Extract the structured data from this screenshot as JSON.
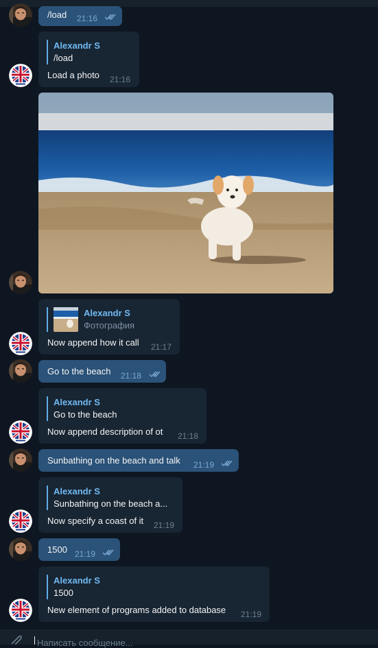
{
  "messages": [
    {
      "text": "/load",
      "time": "21:16"
    },
    {
      "reply_name": "Alexandr S",
      "reply_text": "/load",
      "text": "Load a photo",
      "time": "21:16"
    },
    {
      "reply_name": "Alexandr S",
      "reply_text": "Фотография",
      "text": "Now append how it call",
      "time": "21:17"
    },
    {
      "text": "Go to the beach",
      "time": "21:18"
    },
    {
      "reply_name": "Alexandr S",
      "reply_text": "Go to the beach",
      "text": "Now append description of ot",
      "time": "21:18"
    },
    {
      "text": "Sunbathing on the beach and talk",
      "time": "21:19"
    },
    {
      "reply_name": "Alexandr S",
      "reply_text": "Sunbathing on the beach a...",
      "text": "Now specify a coast of it",
      "time": "21:19"
    },
    {
      "text": "1500",
      "time": "21:19"
    },
    {
      "reply_name": "Alexandr S",
      "reply_text": "1500",
      "text": "New element of programs added to database",
      "time": "21:19"
    }
  ],
  "composer": {
    "placeholder": "Написать сообщение..."
  },
  "colors": {
    "background": "#0e1621",
    "incoming": "#182533",
    "outgoing": "#2b5278",
    "accent": "#71baf2"
  },
  "icons": [
    "user-avatar",
    "bot-avatar-uk-flag",
    "double-check-icon",
    "paperclip-icon"
  ]
}
